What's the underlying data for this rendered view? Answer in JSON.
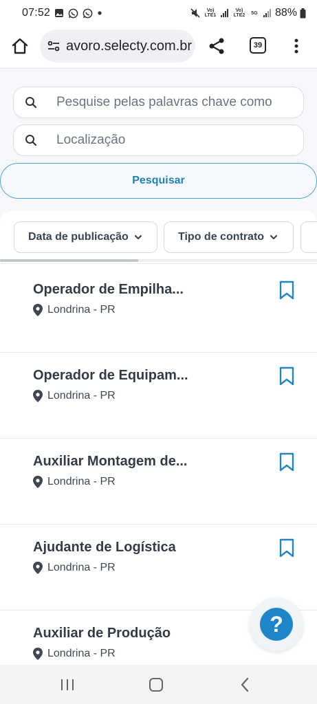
{
  "status": {
    "time": "07:52",
    "battery": "88%",
    "lte1": "Vo) LTE1",
    "lte2": "Vo) LTE2",
    "five_g": "5G"
  },
  "browser": {
    "url": "avoro.selecty.com.br",
    "tabs_count": "39"
  },
  "search": {
    "keywords_placeholder": "Pesquise pelas palavras chave como",
    "location_placeholder": "Localização",
    "button_label": "Pesquisar"
  },
  "filters": [
    {
      "label": "Data de publicação"
    },
    {
      "label": "Tipo de contrato"
    }
  ],
  "jobs": [
    {
      "title": "Operador de Empilha...",
      "location": "Londrina - PR"
    },
    {
      "title": "Operador de Equipam...",
      "location": "Londrina - PR"
    },
    {
      "title": "Auxiliar Montagem de...",
      "location": "Londrina - PR"
    },
    {
      "title": "Ajudante de Logística",
      "location": "Londrina - PR"
    },
    {
      "title": "Auxiliar de Produção",
      "location": "Londrina - PR"
    }
  ],
  "help": {
    "label": "?"
  },
  "colors": {
    "accent": "#1e86c8",
    "button_text": "#1f7fb8",
    "bookmark": "#1e86c8",
    "background": "#f5f7fa"
  },
  "icons": {
    "home": "home-icon",
    "site_settings": "tune-icon",
    "share": "share-icon",
    "menu": "more-vert-icon",
    "search": "search-icon",
    "chevron": "chevron-down-icon",
    "location": "location-pin-icon",
    "bookmark": "bookmark-icon",
    "help": "help-icon"
  }
}
